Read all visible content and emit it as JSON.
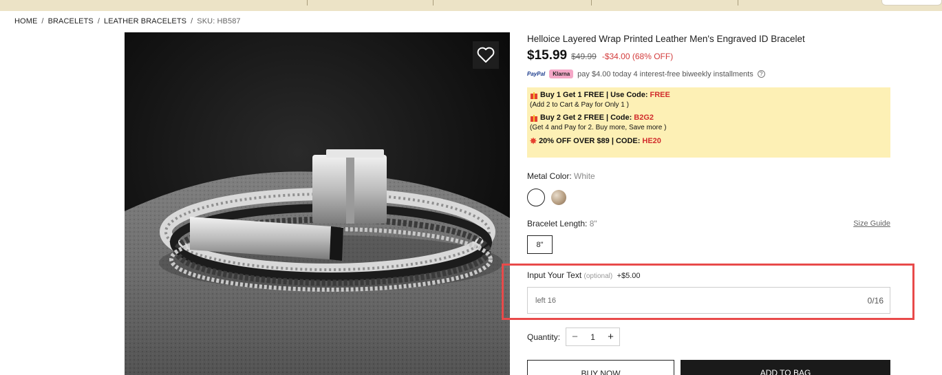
{
  "breadcrumb": {
    "items": [
      "HOME",
      "BRACELETS",
      "LEATHER BRACELETS"
    ],
    "sku": "SKU: HB587",
    "separator": "/"
  },
  "product": {
    "title": "Helloice Layered Wrap Printed Leather Men's Engraved ID Bracelet",
    "price": "$15.99",
    "original_price": "$49.99",
    "discount": "-$34.00 (68% OFF)",
    "image_icon": "bracelet-product-photo"
  },
  "payment": {
    "paypal_label": "PayPal",
    "klarna_label": "Klarna",
    "text": "pay $4.00  today  4 interest-free biweekly installments",
    "help_symbol": "?"
  },
  "promos": [
    {
      "head": "Buy 1 Get 1 FREE | Use Code: ",
      "code": "FREE",
      "sub": "(Add 2 to Cart & Pay for Only 1 )",
      "icon": "gift-icon"
    },
    {
      "head": "Buy 2 Get 2 FREE | Code: ",
      "code": "B2G2",
      "sub": "(Get 4 and Pay for 2. Buy more, Save more )",
      "icon": "gift-icon"
    },
    {
      "head": "20% OFF OVER $89 | CODE: ",
      "code": "HE20",
      "sub": "",
      "icon": "burst-icon"
    }
  ],
  "metal_color": {
    "label": "Metal Color:",
    "selected": "White",
    "options": [
      "White",
      "Gold"
    ]
  },
  "bracelet_length": {
    "label": "Bracelet Length:",
    "selected": "8\"",
    "size_guide": "Size Guide",
    "options": [
      "8\""
    ]
  },
  "engraving": {
    "label": "Input Your Text",
    "optional": "(optional)",
    "fee": "+$5.00",
    "placeholder": "left 16",
    "counter": "0/16"
  },
  "quantity": {
    "label": "Quantity:",
    "value": "1",
    "minus": "−",
    "plus": "+"
  },
  "actions": {
    "buy_now": "BUY NOW",
    "add_to_bag": "ADD TO BAG"
  },
  "colors": {
    "accent_red": "#d12c2c",
    "promo_bg": "#fdf0b5",
    "highlight_border": "#e84a4a",
    "topbar_bg": "#ece3c6"
  }
}
